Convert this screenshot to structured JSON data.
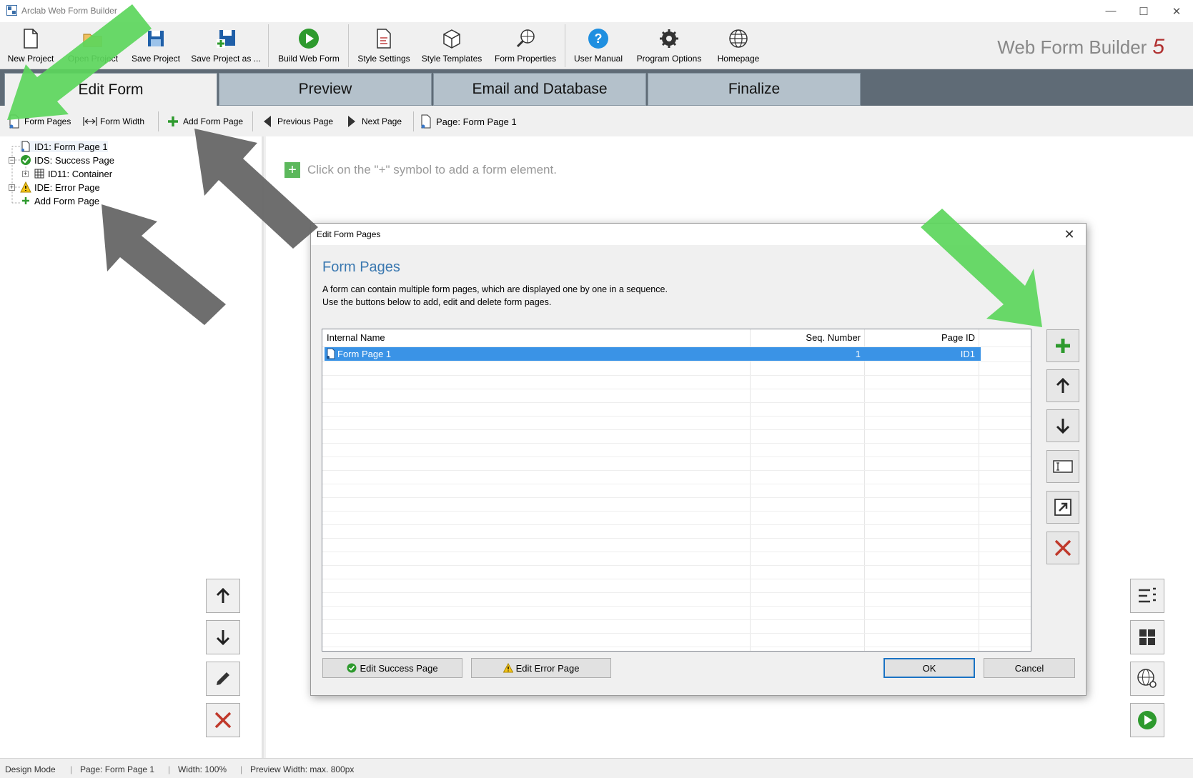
{
  "window": {
    "title": "Arclab Web Form Builder",
    "brand": "Web Form Builder",
    "brand_version": "5"
  },
  "ribbon": {
    "buttons": [
      {
        "label": "New Project",
        "icon": "new-file-icon"
      },
      {
        "label": "Open Project",
        "icon": "open-folder-icon"
      },
      {
        "label": "Save Project",
        "icon": "save-icon"
      },
      {
        "label": "Save Project as ...",
        "icon": "save-as-icon"
      },
      {
        "label": "Build Web Form",
        "icon": "play-icon"
      },
      {
        "label": "Style Settings",
        "icon": "style-settings-icon"
      },
      {
        "label": "Style Templates",
        "icon": "style-templates-icon"
      },
      {
        "label": "Form Properties",
        "icon": "form-properties-icon"
      },
      {
        "label": "User Manual",
        "icon": "help-icon"
      },
      {
        "label": "Program Options",
        "icon": "gear-icon"
      },
      {
        "label": "Homepage",
        "icon": "globe-icon"
      }
    ]
  },
  "tabs": [
    {
      "label": "Edit Form",
      "active": true
    },
    {
      "label": "Preview",
      "active": false
    },
    {
      "label": "Email and Database",
      "active": false
    },
    {
      "label": "Finalize",
      "active": false
    }
  ],
  "toolbar": {
    "form_pages": "Form Pages",
    "form_width": "Form Width",
    "add_form_page": "Add Form Page",
    "previous_page": "Previous Page",
    "next_page": "Next Page",
    "current_page": "Page: Form Page 1"
  },
  "tree": {
    "items": [
      {
        "label": "ID1: Form Page 1"
      },
      {
        "label": "IDS: Success Page"
      },
      {
        "label": "ID11: Container"
      },
      {
        "label": "IDE: Error Page"
      },
      {
        "label": "Add Form Page"
      }
    ]
  },
  "canvas": {
    "hint": "Click on the \"+\" symbol to add a form element."
  },
  "dialog": {
    "title": "Edit Form Pages",
    "heading": "Form Pages",
    "desc1": "A form can contain multiple form pages, which are displayed one by one in a sequence.",
    "desc2": "Use the buttons below to add, edit and delete form pages.",
    "columns": [
      "Internal Name",
      "Seq. Number",
      "Page ID"
    ],
    "rows": [
      {
        "name": "Form Page 1",
        "seq": "1",
        "id": "ID1"
      }
    ],
    "edit_success": "Edit Success Page",
    "edit_error": "Edit Error Page",
    "ok": "OK",
    "cancel": "Cancel"
  },
  "status": {
    "mode": "Design Mode",
    "page": "Page: Form Page 1",
    "width": "Width: 100%",
    "preview_width": "Preview Width: max. 800px"
  },
  "colors": {
    "accent_green": "#5cd65c",
    "overlay_gray": "#666666",
    "selection_blue": "#3a93e6",
    "tab_bar": "#5f6b76"
  }
}
